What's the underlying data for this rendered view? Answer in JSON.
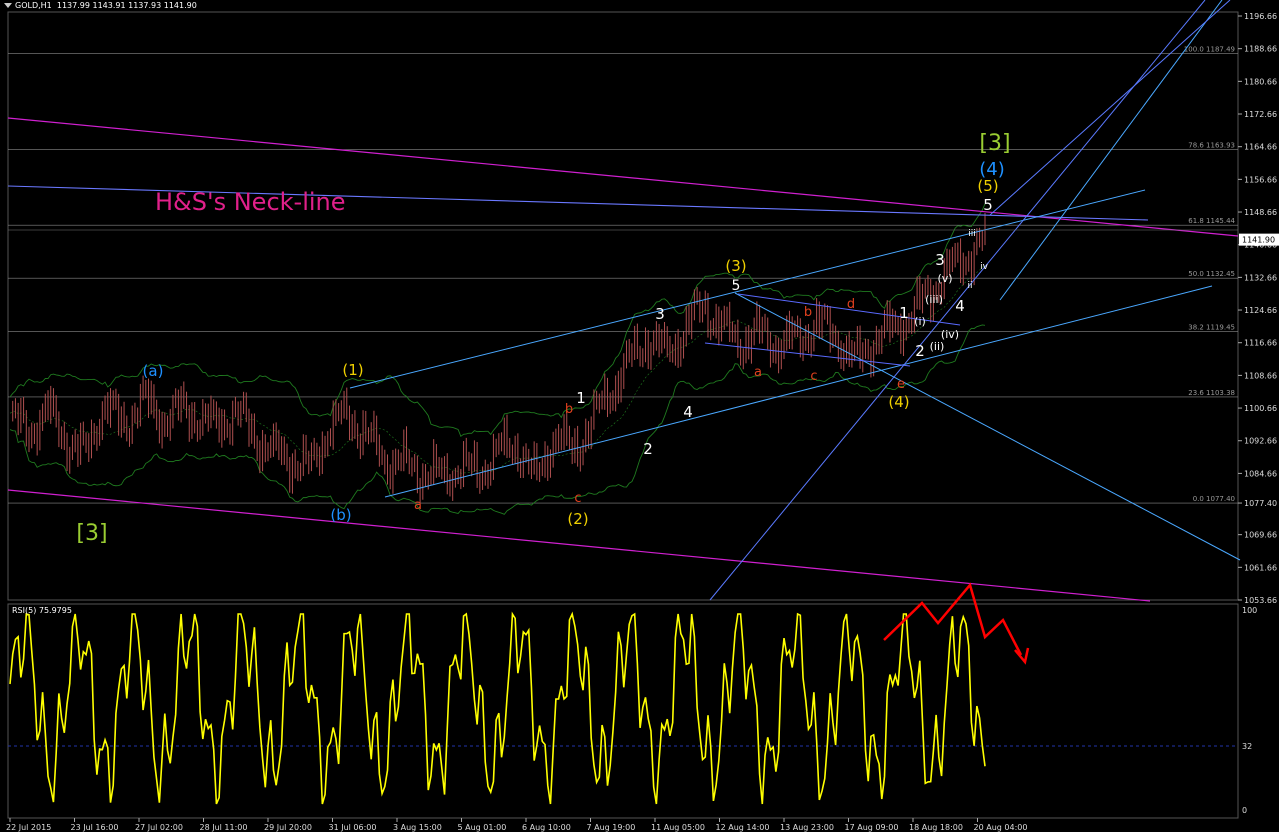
{
  "header": {
    "symbol": "GOLD,H1",
    "ohlc": "1137.99 1143.91 1137.93 1141.90"
  },
  "price_axis": {
    "ticks": [
      "1196.66",
      "1188.66",
      "1180.66",
      "1172.66",
      "1164.66",
      "1156.66",
      "1148.66",
      "1140.66",
      "1132.66",
      "1124.66",
      "1116.66",
      "1108.66",
      "1100.66",
      "1092.66",
      "1084.66",
      "1077.40",
      "1069.66",
      "1061.66",
      "1053.66"
    ],
    "current_price": "1141.90"
  },
  "time_axis": {
    "labels": [
      "22 Jul 2015",
      "23 Jul 16:00",
      "27 Jul 02:00",
      "28 Jul 11:00",
      "29 Jul 20:00",
      "31 Jul 06:00",
      "3 Aug 15:00",
      "5 Aug 01:00",
      "6 Aug 10:00",
      "7 Aug 19:00",
      "11 Aug 05:00",
      "12 Aug 14:00",
      "13 Aug 23:00",
      "17 Aug 09:00",
      "18 Aug 18:00",
      "20 Aug 04:00"
    ]
  },
  "fibonacci": [
    {
      "label": "100.0 1187.49",
      "price": 1187.49
    },
    {
      "label": "78.6 1163.93",
      "price": 1163.93
    },
    {
      "label": "61.8 1145.44",
      "price": 1145.44
    },
    {
      "label": "50.0 1132.45",
      "price": 1132.45
    },
    {
      "label": "38.2 1119.45",
      "price": 1119.45
    },
    {
      "label": "23.6 1103.38",
      "price": 1103.38
    },
    {
      "label": "0.0 1077.40",
      "price": 1077.4
    }
  ],
  "annotation": {
    "neckline": "H&S's Neck-line"
  },
  "wave_labels": [
    {
      "text": "[3]",
      "color": "#9acd32"
    },
    {
      "text": "(a)",
      "color": "#1e90ff"
    },
    {
      "text": "(b)",
      "color": "#1e90ff"
    },
    {
      "text": "(1)",
      "color": "#f0d000"
    },
    {
      "text": "a",
      "color": "#e0401e"
    },
    {
      "text": "b",
      "color": "#e0401e"
    },
    {
      "text": "c",
      "color": "#e0401e"
    },
    {
      "text": "1",
      "color": "#ffffff"
    },
    {
      "text": "(2)",
      "color": "#f0d000"
    },
    {
      "text": "2",
      "color": "#ffffff"
    },
    {
      "text": "3",
      "color": "#ffffff"
    },
    {
      "text": "4",
      "color": "#ffffff"
    },
    {
      "text": "5",
      "color": "#ffffff"
    },
    {
      "text": "(3)",
      "color": "#f0d000"
    },
    {
      "text": "a",
      "color": "#e0401e"
    },
    {
      "text": "b",
      "color": "#e0401e"
    },
    {
      "text": "c",
      "color": "#e0401e"
    },
    {
      "text": "d",
      "color": "#e0401e"
    },
    {
      "text": "e",
      "color": "#e0401e"
    },
    {
      "text": "(4)",
      "color": "#f0d000"
    },
    {
      "text": "1",
      "color": "#ffffff"
    },
    {
      "text": "(i)",
      "color": "#ffffff"
    },
    {
      "text": "2",
      "color": "#ffffff"
    },
    {
      "text": "(ii)",
      "color": "#ffffff"
    },
    {
      "text": "(iii)",
      "color": "#ffffff"
    },
    {
      "text": "(iv)",
      "color": "#ffffff"
    },
    {
      "text": "(v)",
      "color": "#ffffff"
    },
    {
      "text": "3",
      "color": "#ffffff"
    },
    {
      "text": "4",
      "color": "#ffffff"
    },
    {
      "text": "iii",
      "color": "#ffffff"
    },
    {
      "text": "iv",
      "color": "#ffffff"
    },
    {
      "text": "ii",
      "color": "#ffffff"
    },
    {
      "text": "5",
      "color": "#ffffff"
    },
    {
      "text": "(5)",
      "color": "#f0d000"
    },
    {
      "text": "(4)",
      "color": "#1e90ff"
    },
    {
      "text": "[3]",
      "color": "#9acd32"
    }
  ],
  "rsi": {
    "label": "RSI(5) 75.9795",
    "levels": [
      "100",
      "32",
      "0"
    ],
    "level_values": [
      100,
      32,
      0
    ]
  },
  "colors": {
    "candles": "#b05050",
    "bollinger": "#1f7a1f",
    "rsi_line": "#ffff00",
    "channel": "#4aa8ff",
    "magenta": "#d020d0",
    "fib": "#888888",
    "arrow": "#ff0000"
  },
  "chart_data": {
    "type": "line",
    "title": "GOLD,H1",
    "ylim": [
      1053.66,
      1196.66
    ],
    "x_labels": [
      "22 Jul 2015",
      "23 Jul 16:00",
      "27 Jul 02:00",
      "28 Jul 11:00",
      "29 Jul 20:00",
      "31 Jul 06:00",
      "3 Aug 15:00",
      "5 Aug 01:00",
      "6 Aug 10:00",
      "7 Aug 19:00",
      "11 Aug 05:00",
      "12 Aug 14:00",
      "13 Aug 23:00",
      "17 Aug 09:00",
      "18 Aug 18:00",
      "20 Aug 04:00"
    ],
    "series": [
      {
        "name": "GOLD,H1",
        "values": [
          1098,
          1095,
          1100,
          1093,
          1089,
          1102,
          1096,
          1103,
          1098,
          1100,
          1099,
          1096,
          1100,
          1094,
          1090,
          1088,
          1086,
          1096,
          1099,
          1094,
          1088,
          1087,
          1085,
          1084,
          1086,
          1085,
          1090,
          1092,
          1083,
          1094,
          1090,
          1097,
          1105,
          1112,
          1118,
          1114,
          1120,
          1126,
          1120,
          1117,
          1119,
          1116,
          1118,
          1121,
          1119,
          1112,
          1117,
          1120,
          1123,
          1129,
          1134,
          1138,
          1141.9
        ]
      }
    ],
    "rsi_ylim": [
      0,
      100
    ]
  }
}
